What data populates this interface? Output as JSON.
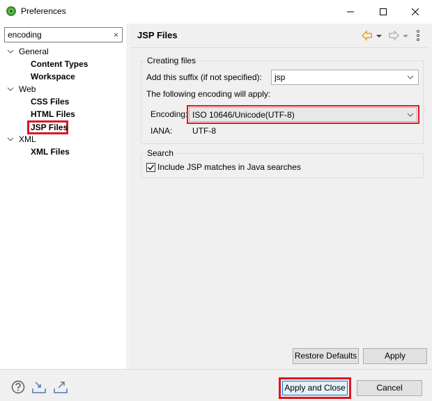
{
  "window": {
    "title": "Preferences"
  },
  "filter": {
    "value": "encoding",
    "clear_icon": "×"
  },
  "tree": {
    "general": "General",
    "content_types": "Content Types",
    "workspace": "Workspace",
    "web": "Web",
    "css_files": "CSS Files",
    "html_files": "HTML Files",
    "jsp_files": "JSP Files",
    "xml": "XML",
    "xml_files": "XML Files"
  },
  "page": {
    "title": "JSP Files"
  },
  "creating": {
    "group_title": "Creating files",
    "suffix_label": "Add this suffix (if not specified):",
    "suffix_value": "jsp",
    "encoding_note": "The following encoding will apply:",
    "encoding_label": "Encoding:",
    "encoding_value": "ISO 10646/Unicode(UTF-8)",
    "iana_label": "IANA:",
    "iana_value": "UTF-8"
  },
  "search": {
    "group_title": "Search",
    "include_label": "Include JSP matches in Java searches",
    "include_checked": true
  },
  "buttons": {
    "restore_defaults": "Restore Defaults",
    "apply": "Apply",
    "apply_and_close": "Apply and Close",
    "cancel": "Cancel"
  },
  "colors": {
    "highlight": "#e0141f",
    "nav_accent": "#e8a317"
  }
}
